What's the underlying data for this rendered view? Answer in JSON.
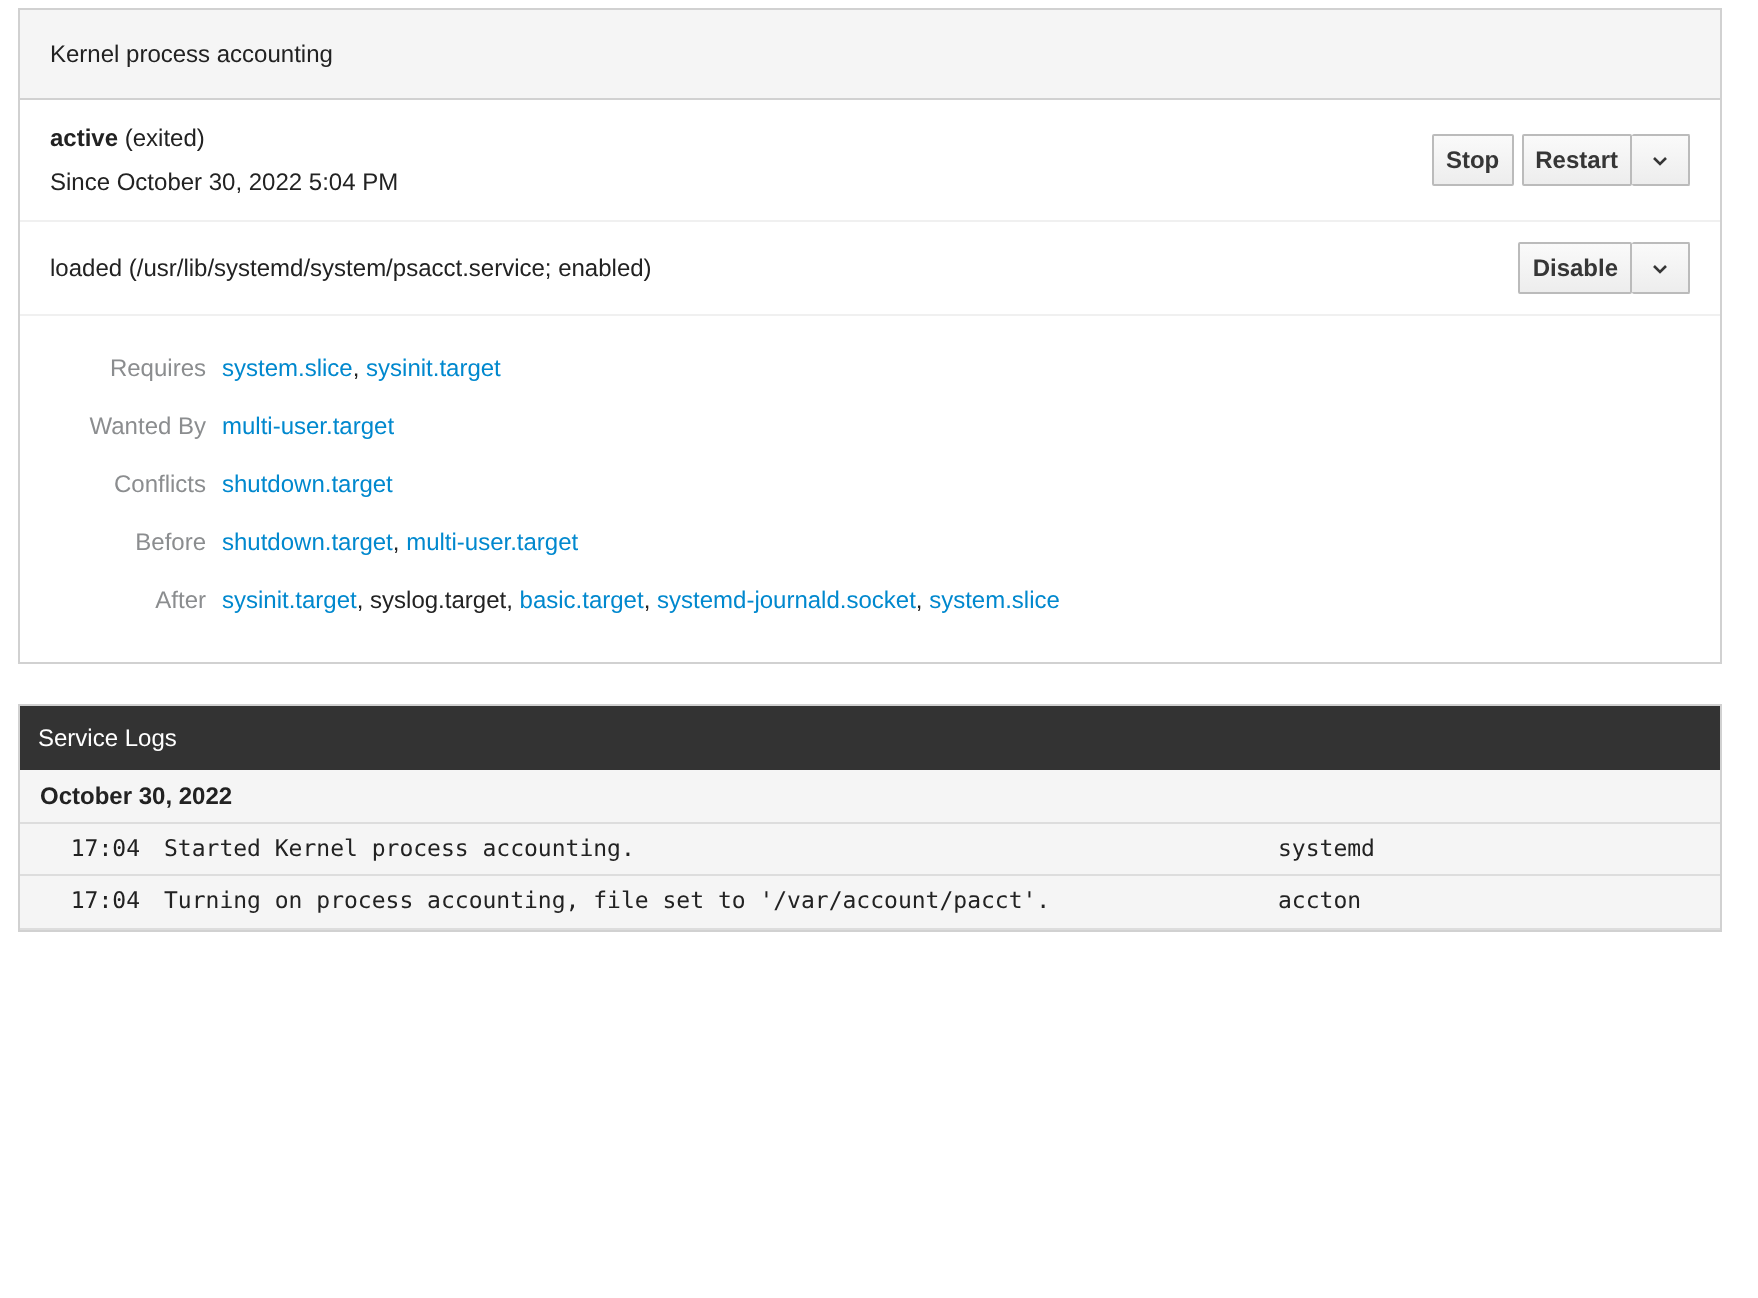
{
  "unit": {
    "title": "Kernel process accounting",
    "status": "**active** (exited)",
    "since": "Since October 30, 2022 5:04 PM",
    "status_buttons": [
      {
        "label": "Stop",
        "kind": "plain"
      },
      {
        "label": "Restart",
        "kind": "split"
      }
    ],
    "loaded": "loaded (/usr/lib/systemd/system/psacct.service; enabled)",
    "file_buttons": [
      {
        "label": "Disable",
        "kind": "split"
      }
    ],
    "relations": [
      {
        "label": "Requires",
        "items": [
          {
            "text": "system.slice",
            "link": true,
            "sep": ","
          },
          {
            "text": "sysinit.target",
            "link": true
          }
        ]
      },
      {
        "label": "Wanted By",
        "items": [
          {
            "text": "multi-user.target",
            "link": true
          }
        ]
      },
      {
        "label": "Conflicts",
        "items": [
          {
            "text": "shutdown.target",
            "link": true
          }
        ]
      },
      {
        "label": "Before",
        "items": [
          {
            "text": "shutdown.target",
            "link": true,
            "sep": ","
          },
          {
            "text": "multi-user.target",
            "link": true
          }
        ]
      },
      {
        "label": "After",
        "items": [
          {
            "text": "sysinit.target",
            "link": true,
            "sep": ","
          },
          {
            "text": "syslog.target",
            "link": false,
            "sep": ","
          },
          {
            "text": "basic.target",
            "link": true,
            "sep": ","
          },
          {
            "text": "systemd-journald.socket",
            "link": true,
            "sep": ","
          },
          {
            "text": "system.slice",
            "link": true
          }
        ]
      }
    ]
  },
  "logs": {
    "title": "Service Logs",
    "groups": [
      {
        "date": "October 30, 2022",
        "entries": [
          {
            "time": "17:04",
            "message": "Started Kernel process accounting.",
            "source": "systemd"
          },
          {
            "time": "17:04",
            "message": "Turning on process accounting, file set to '/var/account/pacct'.",
            "source": "accton"
          }
        ]
      }
    ]
  }
}
